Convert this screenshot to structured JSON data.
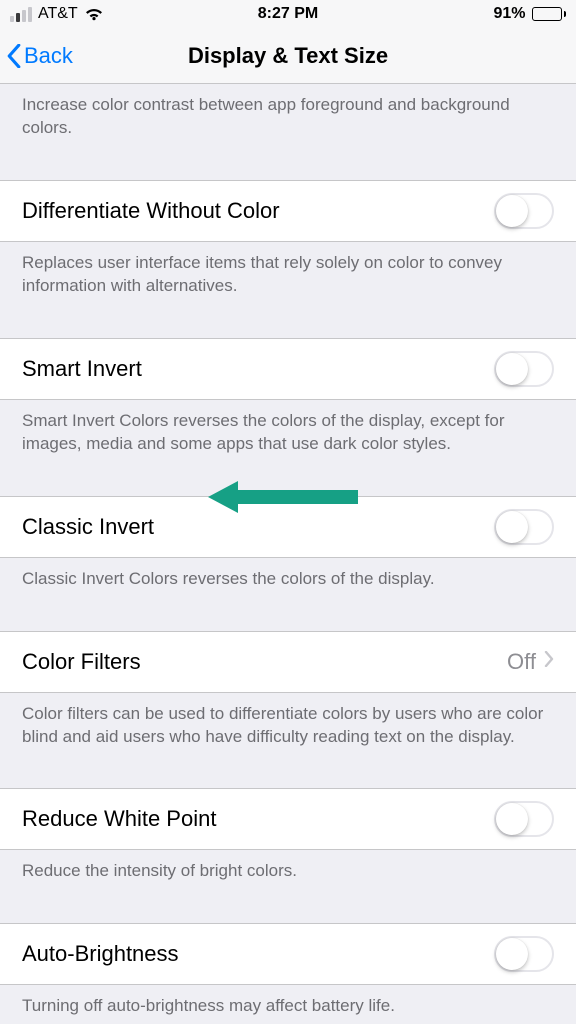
{
  "status": {
    "carrier": "AT&T",
    "time": "8:27 PM",
    "battery_pct": "91%"
  },
  "nav": {
    "back_label": "Back",
    "title": "Display & Text Size"
  },
  "groups": {
    "contrast_footer": "Increase color contrast between app foreground and background colors.",
    "diff_color": {
      "label": "Differentiate Without Color",
      "footer": "Replaces user interface items that rely solely on color to convey information with alternatives."
    },
    "smart_invert": {
      "label": "Smart Invert",
      "footer": "Smart Invert Colors reverses the colors of the display, except for images, media and some apps that use dark color styles."
    },
    "classic_invert": {
      "label": "Classic Invert",
      "footer": "Classic Invert Colors reverses the colors of the display."
    },
    "color_filters": {
      "label": "Color Filters",
      "value": "Off",
      "footer": "Color filters can be used to differentiate colors by users who are color blind and aid users who have difficulty reading text on the display."
    },
    "reduce_white": {
      "label": "Reduce White Point",
      "footer": "Reduce the intensity of bright colors."
    },
    "auto_brightness": {
      "label": "Auto-Brightness",
      "footer": "Turning off auto-brightness may affect battery life."
    }
  }
}
